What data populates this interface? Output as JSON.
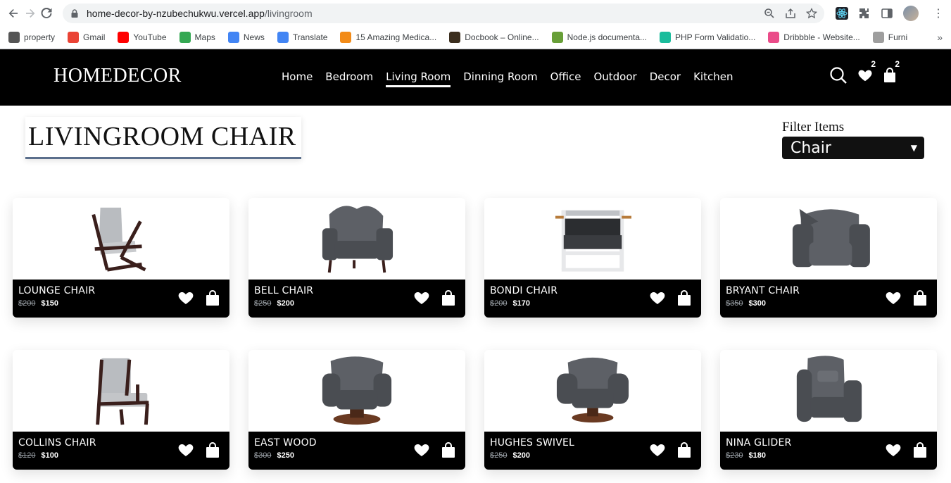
{
  "browser": {
    "url_host": "home-decor-by-nzubechukwu.vercel.app",
    "url_path": "/livingroom",
    "bookmarks": [
      {
        "label": "property",
        "color": "#555555",
        "icon": "property-icon"
      },
      {
        "label": "Gmail",
        "color": "#ea4335",
        "icon": "gmail-icon"
      },
      {
        "label": "YouTube",
        "color": "#ff0000",
        "icon": "youtube-icon"
      },
      {
        "label": "Maps",
        "color": "#34a853",
        "icon": "maps-icon"
      },
      {
        "label": "News",
        "color": "#4285f4",
        "icon": "news-icon"
      },
      {
        "label": "Translate",
        "color": "#4285f4",
        "icon": "translate-icon"
      },
      {
        "label": "15 Amazing Medica...",
        "color": "#f28b18",
        "icon": "bookmark-icon"
      },
      {
        "label": "Docbook – Online...",
        "color": "#3b2e1e",
        "icon": "bookmark-icon"
      },
      {
        "label": "Node.js documenta...",
        "color": "#689f38",
        "icon": "bookmark-icon"
      },
      {
        "label": "PHP Form Validatio...",
        "color": "#1abc9c",
        "icon": "bookmark-icon"
      },
      {
        "label": "Dribbble - Website...",
        "color": "#ea4c89",
        "icon": "dribbble-icon"
      },
      {
        "label": "Furni",
        "color": "#9e9e9e",
        "icon": "bookmark-icon"
      }
    ]
  },
  "site": {
    "logo": "HOMEDECOR",
    "nav": [
      {
        "label": "Home",
        "active": false
      },
      {
        "label": "Bedroom",
        "active": false
      },
      {
        "label": "Living Room",
        "active": true
      },
      {
        "label": "Dinning Room",
        "active": false
      },
      {
        "label": "Office",
        "active": false
      },
      {
        "label": "Outdoor",
        "active": false
      },
      {
        "label": "Decor",
        "active": false
      },
      {
        "label": "Kitchen",
        "active": false
      }
    ],
    "wishlist_count": "2",
    "cart_count": "2"
  },
  "page": {
    "title": "LIVINGROOM CHAIR",
    "filter_label": "Filter Items",
    "filter_value": "Chair"
  },
  "products": [
    {
      "name": "LOUNGE CHAIR",
      "old_price": "$200",
      "price": "$150",
      "style": "lounge"
    },
    {
      "name": "BELL CHAIR",
      "old_price": "$250",
      "price": "$200",
      "style": "bell"
    },
    {
      "name": "BONDI CHAIR",
      "old_price": "$200",
      "price": "$170",
      "style": "bondi"
    },
    {
      "name": "BRYANT CHAIR",
      "old_price": "$350",
      "price": "$300",
      "style": "bryant"
    },
    {
      "name": "COLLINS CHAIR",
      "old_price": "$120",
      "price": "$100",
      "style": "collins"
    },
    {
      "name": "EAST WOOD",
      "old_price": "$300",
      "price": "$250",
      "style": "swivel"
    },
    {
      "name": "HUGHES SWIVEL",
      "old_price": "$250",
      "price": "$200",
      "style": "swivel2"
    },
    {
      "name": "NINA GLIDER",
      "old_price": "$230",
      "price": "$180",
      "style": "glider"
    }
  ]
}
